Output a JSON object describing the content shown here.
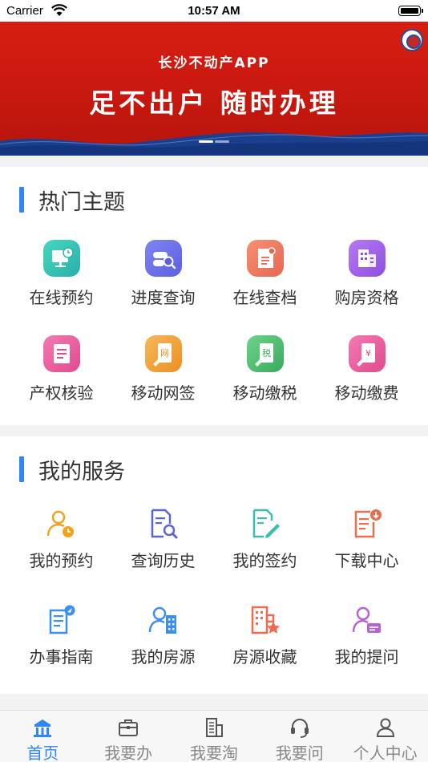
{
  "status_bar": {
    "carrier": "Carrier",
    "time": "10:57 AM"
  },
  "banner": {
    "app_name": "长沙不动产APP",
    "slogan": "足不出户 随时办理",
    "slides": 2,
    "active_slide": 1
  },
  "hot_topics": {
    "title": "热门主题",
    "items": [
      {
        "label": "在线预约",
        "icon": "online-appointment-icon",
        "color": "#35c4b5"
      },
      {
        "label": "进度查询",
        "icon": "progress-query-icon",
        "color": "#6a6ee8"
      },
      {
        "label": "在线查档",
        "icon": "archive-query-icon",
        "color": "#ee7b62"
      },
      {
        "label": "购房资格",
        "icon": "purchase-eligibility-icon",
        "color": "#a064e8"
      },
      {
        "label": "产权核验",
        "icon": "property-verify-icon",
        "color": "#ea5c9e"
      },
      {
        "label": "移动网签",
        "icon": "online-sign-icon",
        "color": "#f0a23c"
      },
      {
        "label": "移动缴税",
        "icon": "tax-payment-icon",
        "color": "#4cbd6e"
      },
      {
        "label": "移动缴费",
        "icon": "fee-payment-icon",
        "color": "#ea5c9e"
      }
    ]
  },
  "my_services": {
    "title": "我的服务",
    "items": [
      {
        "label": "我的预约",
        "icon": "my-appointment-icon",
        "color": "#f2a31c"
      },
      {
        "label": "查询历史",
        "icon": "query-history-icon",
        "color": "#5b64d9"
      },
      {
        "label": "我的签约",
        "icon": "my-contract-icon",
        "color": "#39bfb0"
      },
      {
        "label": "下载中心",
        "icon": "download-center-icon",
        "color": "#ee6b4e"
      },
      {
        "label": "办事指南",
        "icon": "service-guide-icon",
        "color": "#3c8ff0"
      },
      {
        "label": "我的房源",
        "icon": "my-listings-icon",
        "color": "#3c8ff0"
      },
      {
        "label": "房源收藏",
        "icon": "listing-favorites-icon",
        "color": "#ee6b4e"
      },
      {
        "label": "我的提问",
        "icon": "my-questions-icon",
        "color": "#b662d8"
      }
    ]
  },
  "tabbar": {
    "items": [
      {
        "label": "首页",
        "icon": "home-icon",
        "active": true
      },
      {
        "label": "我要办",
        "icon": "briefcase-icon",
        "active": false
      },
      {
        "label": "我要淘",
        "icon": "building-icon",
        "active": false
      },
      {
        "label": "我要问",
        "icon": "headset-icon",
        "active": false
      },
      {
        "label": "个人中心",
        "icon": "user-icon",
        "active": false
      }
    ],
    "active_color": "#2f86f6",
    "inactive_color": "#888888"
  }
}
